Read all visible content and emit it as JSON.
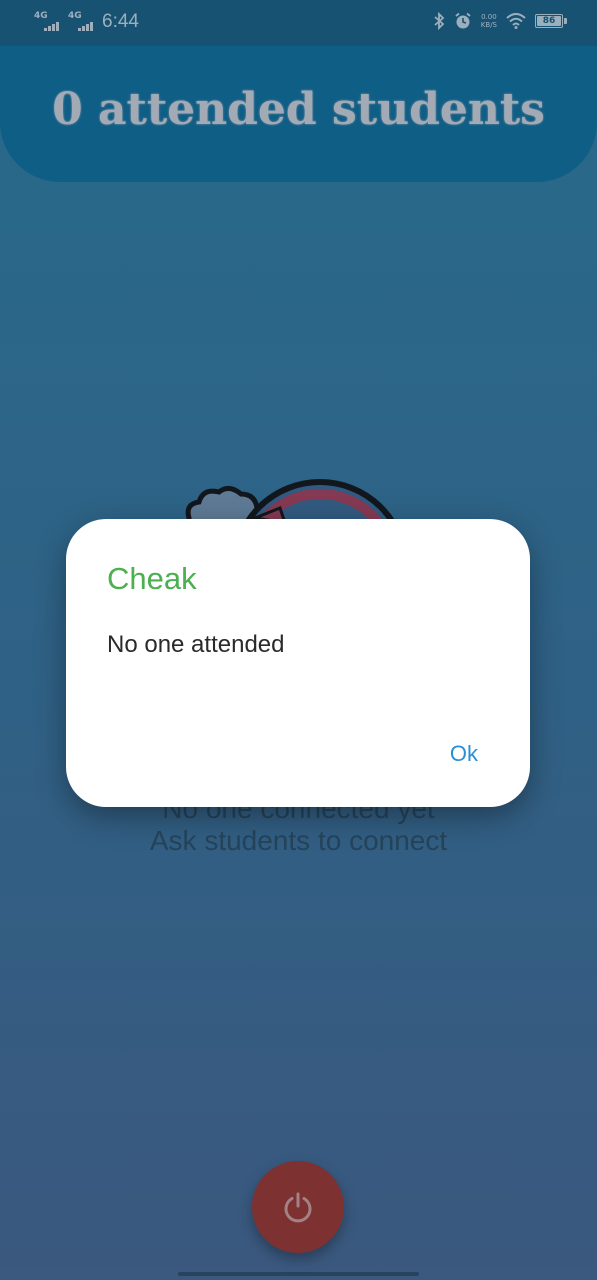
{
  "status_bar": {
    "network_1": "4G",
    "network_2": "4G",
    "time": "6:44",
    "speed_value": "0.00",
    "speed_unit": "KB/S",
    "battery": "86",
    "icons": [
      "bluetooth-icon",
      "alarm-icon",
      "wifi-icon",
      "battery-icon"
    ]
  },
  "header": {
    "title": "0 attended students"
  },
  "empty_state": {
    "line1": "No one connected yet",
    "line2": "Ask students to connect"
  },
  "dialog": {
    "title": "Cheak",
    "message": "No one attended",
    "ok_label": "Ok"
  },
  "fab": {
    "icon": "power-icon"
  },
  "colors": {
    "header": "#0d73a3",
    "dialog_title": "#4caf50",
    "ok_button": "#2a8fd6",
    "fab": "#a6362d"
  }
}
